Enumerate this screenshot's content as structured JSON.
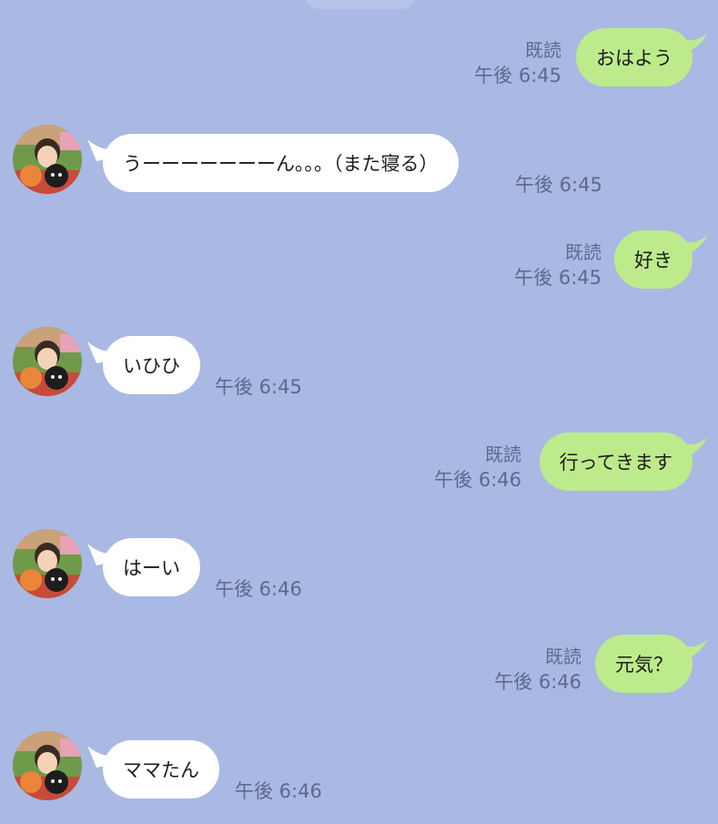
{
  "messages": [
    {
      "side": "out",
      "text": "おはよう",
      "read": "既読",
      "time": "午後 6:45"
    },
    {
      "side": "in",
      "text": "うーーーーーーーん。。。（また寝る）",
      "time": "午後 6:45"
    },
    {
      "side": "out",
      "text": "好き",
      "read": "既読",
      "time": "午後 6:45"
    },
    {
      "side": "in",
      "text": "いひひ",
      "time": "午後 6:45"
    },
    {
      "side": "out",
      "text": "行ってきます",
      "read": "既読",
      "time": "午後 6:46"
    },
    {
      "side": "in",
      "text": "はーい",
      "time": "午後 6:46"
    },
    {
      "side": "out",
      "text": "元気？",
      "read": "既読",
      "time": "午後 6:46"
    },
    {
      "side": "in",
      "text": "ママたん",
      "time": "午後 6:46"
    }
  ],
  "colors": {
    "background": "#a9b9e3",
    "outgoing_bubble": "#bdeb8c",
    "incoming_bubble": "#ffffff",
    "meta_text": "#5b6a8e"
  }
}
